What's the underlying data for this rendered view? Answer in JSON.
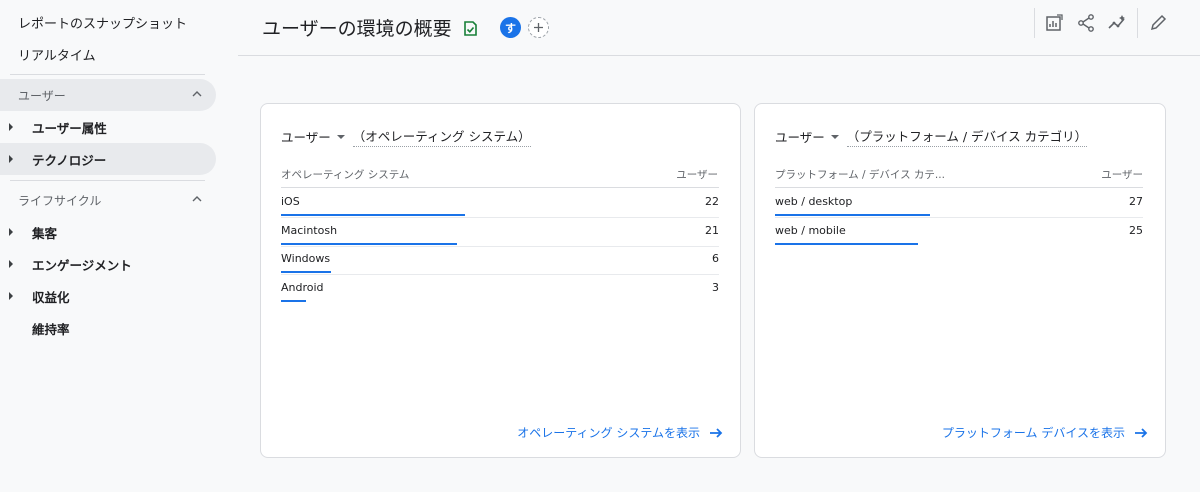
{
  "sidebar": {
    "top_items": [
      "レポートのスナップショット",
      "リアルタイム"
    ],
    "sections": [
      {
        "label": "ユーザー",
        "items": [
          "ユーザー属性",
          "テクノロジー"
        ]
      },
      {
        "label": "ライフサイクル",
        "items": [
          "集客",
          "エンゲージメント",
          "収益化",
          "維持率"
        ]
      }
    ],
    "active_item": "テクノロジー"
  },
  "header": {
    "title": "ユーザーの環境の概要",
    "avatar_letter": "す",
    "add_symbol": "+"
  },
  "cards": [
    {
      "metric": "ユーザー",
      "dimension": "（オペレーティング システム）",
      "col_dimension": "オペレーティング システム",
      "col_metric": "ユーザー",
      "rows": [
        {
          "label": "iOS",
          "value": 22
        },
        {
          "label": "Macintosh",
          "value": 21
        },
        {
          "label": "Windows",
          "value": 6
        },
        {
          "label": "Android",
          "value": 3
        }
      ],
      "max_value": 22,
      "link": "オペレーティング システムを表示"
    },
    {
      "metric": "ユーザー",
      "dimension": "（プラットフォーム / デバイス カテゴリ）",
      "col_dimension": "プラットフォーム / デバイス カテ...",
      "col_metric": "ユーザー",
      "rows": [
        {
          "label": "web / desktop",
          "value": 27
        },
        {
          "label": "web / mobile",
          "value": 25
        }
      ],
      "max_value": 27,
      "link": "プラットフォーム デバイスを表示"
    }
  ],
  "colors": {
    "accent": "#1a73e8",
    "check": "#188038",
    "active_bg": "#e8eaed"
  },
  "icons": [
    "check-icon",
    "add-icon",
    "customize-report-icon",
    "share-icon",
    "insights-icon",
    "edit-icon",
    "arrow-right-icon",
    "chevron-up-icon"
  ]
}
